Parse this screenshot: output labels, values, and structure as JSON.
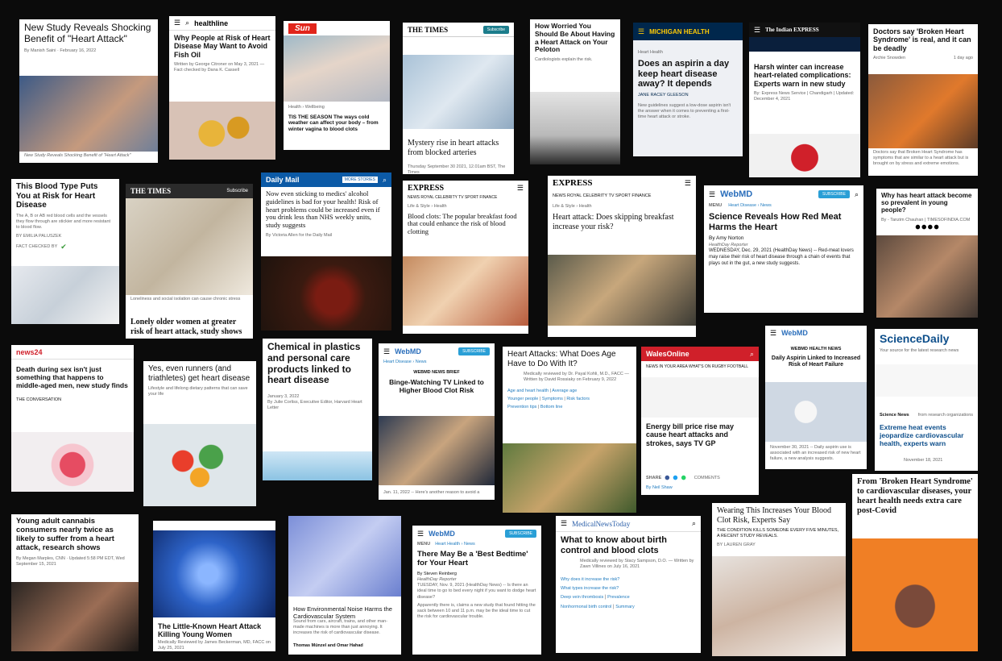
{
  "c1": {
    "title": "New Study Reveals Shocking Benefit of \"Heart Attack\"",
    "byline": "By Manish Saini · February 16, 2022",
    "caption": "New Study Reveals Shocking Benefit of \"Heart Attack\""
  },
  "c2": {
    "brand": "healthline",
    "title": "Why People at Risk of Heart Disease May Want to Avoid Fish Oil",
    "meta": "Written by George Citroner on May 3, 2021 — Fact checked by Dana K. Cassell"
  },
  "c3": {
    "brand": "Sun",
    "section": "Health › Wellbeing",
    "title": "TIS THE SEASON The ways cold weather can affect your body – from winter vagina to blood clots"
  },
  "c4": {
    "brand": "THE TIMES",
    "title": "Mystery rise in heart attacks from blocked arteries",
    "meta": "Thursday September 30 2021, 12.01am BST, The Times"
  },
  "c5": {
    "title": "How Worried You Should Be About Having a Heart Attack on Your Peloton",
    "subtitle": "Cardiologists explain the risk."
  },
  "c6": {
    "brand": "MICHIGAN HEALTH",
    "section": "Heart Health",
    "title": "Does an aspirin a day keep heart disease away? It depends",
    "author": "JANE RACEY GLEESON",
    "body": "New guidelines suggest a low-dose aspirin isn't the answer when it comes to preventing a first-time heart attack or stroke."
  },
  "c7": {
    "brand": "The Indian EXPRESS",
    "title": "Harsh winter can increase heart-related complications: Experts warn in new study",
    "meta": "By: Express News Service | Chandigarh | Updated: December 4, 2021"
  },
  "c8": {
    "title": "Doctors say 'Broken Heart Syndrome' is real, and it can be deadly",
    "author": "Archie Snowden",
    "time": "1 day ago",
    "caption": "Doctors say that Broken Heart Syndrome has symptoms that are similar to a heart attack but is brought on by stress and extreme emotions."
  },
  "c9": {
    "title": "This Blood Type Puts You at Risk for Heart Disease",
    "subtitle": "The A, B or AB red blood cells and the vessels they flow through are stickier and more resistant to blood flow.",
    "byline": "BY EMILIA PALUSZEK",
    "badge": "FACT CHECKED BY"
  },
  "c10": {
    "brand": "THE TIMES",
    "title": "Lonely older women at greater risk of heart attack, study shows",
    "caption": "Loneliness and social isolation can cause chronic stress"
  },
  "c11": {
    "brand": "Daily Mail",
    "more": "MORE STORIES",
    "title": "Now even sticking to medics' alcohol guidelines is bad for your health! Risk of heart problems could be increased even if you drink less than NHS weekly units, study suggests",
    "byline": "By Victoria Allen for the Daily Mail"
  },
  "c12": {
    "brand": "EXPRESS",
    "nav": "NEWS  ROYAL  CELEBRITY  TV  SPORT  FINANCE",
    "crumb": "Life & Style › Health",
    "title": "Blood clots: The popular breakfast food that could enhance the risk of blood clotting"
  },
  "c13": {
    "brand": "EXPRESS",
    "nav": "NEWS  ROYAL  CELEBRITY  TV  SPORT  FINANCE",
    "crumb": "Life & Style › Health",
    "title": "Heart attack: Does skipping breakfast increase your risk?"
  },
  "c14": {
    "brand": "WebMD",
    "subscribe": "SUBSCRIBE",
    "menu": "MENU",
    "crumb": "Heart Disease › News",
    "title": "Science Reveals How Red Meat Harms the Heart",
    "author": "By Amy Norton",
    "reporter": "HealthDay Reporter",
    "body": "WEDNESDAY, Dec. 29, 2021 (HealthDay News) -- Red-meat lovers may raise their risk of heart disease through a chain of events that plays out in the gut, a new study suggests."
  },
  "c15": {
    "title": "Why has heart attack become so prevalent in young people?",
    "meta": "By - Tanzim Chauhan | TIMESOFINDIA.COM"
  },
  "c16": {
    "brand": "news24",
    "title": "Death during sex isn't just something that happens to middle-aged men, new study finds",
    "source": "THE CONVERSATION"
  },
  "c17": {
    "title": "Yes, even runners (and triathletes) get heart disease",
    "subtitle": "Lifestyle and lifelong dietary patterns that can save your life"
  },
  "c18": {
    "title": "Chemical in plastics and personal care products linked to heart disease",
    "date": "January 3, 2022",
    "author": "By Julie Corliss, Executive Editor, Harvard Heart Letter"
  },
  "c19": {
    "brand": "WebMD",
    "subscribe": "SUBSCRIBE",
    "crumb": "Heart Disease › News",
    "tag": "WEBMD NEWS BRIEF",
    "title": "Binge-Watching TV Linked to Higher Blood Clot Risk",
    "foot": "Jan. 11, 2022 -- Here's another reason to avoid a"
  },
  "c20": {
    "title": "Heart Attacks: What Does Age Have to Do With It?",
    "meta": "Medically reviewed by Dr. Payal Kohli, M.D., FACC — Written by David Rossiaky on February 9, 2022",
    "links": [
      "Age and heart health",
      "Average age",
      "Younger people",
      "Symptoms",
      "Risk factors",
      "Prevention tips",
      "Bottom line"
    ]
  },
  "c21": {
    "brand": "WalesOnline",
    "nav": "NEWS  IN YOUR AREA  WHAT'S ON  RUGBY  FOOTBALL",
    "title": "Energy bill price rise may cause heart attacks and strokes, says TV GP",
    "share": "SHARE",
    "comments": "COMMENTS",
    "author": "By Neil Shaw"
  },
  "c22": {
    "brand": "WebMD",
    "tag": "WEBMD HEALTH NEWS",
    "title": "Daily Aspirin Linked to Increased Risk of Heart Failure",
    "meta": "November 30, 2021 -- Daily aspirin use is associated with an increased risk of new heart failure, a new analysis suggests."
  },
  "c23": {
    "brand": "ScienceDaily",
    "tagline": "Your source for the latest research news",
    "section": "Science News",
    "from": "from research organizations",
    "title": "Extreme heat events jeopardize cardiovascular health, experts warn",
    "date": "November 18, 2021"
  },
  "c24": {
    "title": "Young adult cannabis consumers nearly twice as likely to suffer from a heart attack, research shows",
    "meta": "By Megan Marples, CNN · Updated 5:58 PM EDT, Wed September 15, 2021"
  },
  "c25": {
    "title": "The Little-Known Heart Attack Killing Young Women",
    "meta": "Medically Reviewed by James Beckerman, MD, FACC on July 25, 2021"
  },
  "c26": {
    "title": "How Environmental Noise Harms the Cardiovascular System",
    "body": "Sound from cars, aircraft, trains, and other man-made machines is more than just annoying. It increases the risk of cardiovascular disease.",
    "author": "Thomas Münzel and Omar Hahad"
  },
  "c27": {
    "brand": "WebMD",
    "subscribe": "SUBSCRIBE",
    "menu": "MENU",
    "crumb": "Heart Health › News",
    "title": "There May Be a 'Best Bedtime' for Your Heart",
    "author": "By Steven Reinberg",
    "reporter": "HealthDay Reporter",
    "body": "TUESDAY, Nov. 9, 2021 (HealthDay News) -- Is there an ideal time to go to bed every night if you want to dodge heart disease?",
    "body2": "Apparently there is, claims a new study that found hitting the sack between 10 and 11 p.m. may be the ideal time to cut the risk for cardiovascular trouble."
  },
  "c28": {
    "brand": "MedicalNewsToday",
    "title": "What to know about birth control and blood clots",
    "meta": "Medically reviewed by Stacy Sampson, D.O. — Written by Zawn Villines on July 16, 2021",
    "links": [
      "Why does it increase the risk?",
      "What types increase the risk?",
      "Deep vein thrombosis",
      "Prevalence",
      "Nonhormonal birth control",
      "Summary"
    ]
  },
  "c29": {
    "title": "Wearing This Increases Your Blood Clot Risk, Experts Say",
    "subtitle": "THE CONDITION KILLS SOMEONE EVERY FIVE MINUTES, A RECENT STUDY REVEALS.",
    "author": "BY LAUREN GRAY"
  },
  "c30": {
    "title": "From 'Broken Heart Syndrome' to cardiovascular diseases, your heart health needs extra care post-Covid"
  }
}
